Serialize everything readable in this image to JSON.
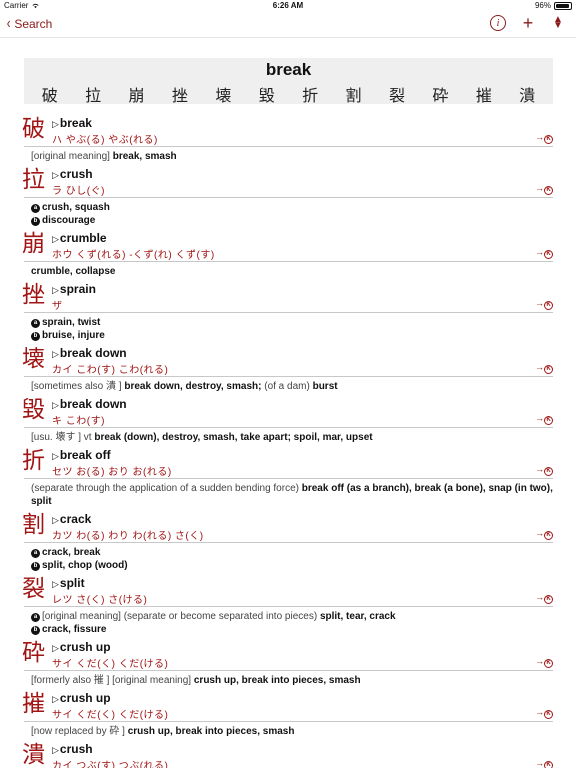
{
  "status": {
    "carrier": "Carrier",
    "time": "6:26 AM",
    "battery": "96%"
  },
  "nav": {
    "back_label": "Search"
  },
  "header": {
    "word": "break",
    "kanji": [
      "破",
      "拉",
      "崩",
      "挫",
      "壊",
      "毀",
      "折",
      "割",
      "裂",
      "砕",
      "摧",
      "潰"
    ]
  },
  "entries": [
    {
      "kanji": "破",
      "keyword": "break",
      "readings": "ハ  やぶ(る)  やぶ(れる)",
      "defs": [
        {
          "gray": "[original meaning]",
          "bold": "break, smash"
        }
      ]
    },
    {
      "kanji": "拉",
      "keyword": "crush",
      "readings": "ラ  ひし(ぐ)",
      "defs": [
        {
          "mark": "a",
          "bold": "crush, squash"
        },
        {
          "mark": "b",
          "bold": "discourage"
        }
      ]
    },
    {
      "kanji": "崩",
      "keyword": "crumble",
      "readings": "ホウ  くず(れる)  -くず(れ)  くず(す)",
      "defs": [
        {
          "bold": "crumble, collapse"
        }
      ]
    },
    {
      "kanji": "挫",
      "keyword": "sprain",
      "readings": "ザ",
      "defs": [
        {
          "mark": "a",
          "bold": "sprain, twist"
        },
        {
          "mark": "b",
          "bold": "bruise, injure"
        }
      ]
    },
    {
      "kanji": "壊",
      "keyword": "break down",
      "readings": "カイ  こわ(す)  こわ(れる)",
      "defs": [
        {
          "gray": "[sometimes also 潰 ]",
          "bold": "break down, destroy, smash;",
          "gray2": "(of a dam)",
          "bold2": "burst"
        }
      ]
    },
    {
      "kanji": "毀",
      "keyword": "break down",
      "readings": "キ  こわ(す)",
      "defs": [
        {
          "gray": "[usu. 壊す ] vt",
          "bold": "break (down), destroy, smash, take apart; spoil, mar, upset"
        }
      ]
    },
    {
      "kanji": "折",
      "keyword": "break off",
      "readings": "セツ  お(る)  おり  お(れる)",
      "defs": [
        {
          "gray": "(separate through the application of a sudden bending force)",
          "bold": "break off (as a branch), break (a bone), snap (in two), split"
        }
      ]
    },
    {
      "kanji": "割",
      "keyword": "crack",
      "readings": "カツ  わ(る)  わり  わ(れる)  さ(く)",
      "defs": [
        {
          "mark": "a",
          "bold": "crack, break"
        },
        {
          "mark": "b",
          "bold": "split, chop (wood)"
        }
      ]
    },
    {
      "kanji": "裂",
      "keyword": "split",
      "readings": "レツ  さ(く)  さ(ける)",
      "defs": [
        {
          "mark": "a",
          "gray": "[original meaning] (separate or become separated into pieces)",
          "bold": "split, tear, crack"
        },
        {
          "mark": "b",
          "bold": "crack, fissure"
        }
      ]
    },
    {
      "kanji": "砕",
      "keyword": "crush up",
      "readings": "サイ  くだ(く)  くだ(ける)",
      "defs": [
        {
          "gray": "[formerly also 摧 ] [original meaning]",
          "bold": "crush up, break into pieces, smash"
        }
      ]
    },
    {
      "kanji": "摧",
      "keyword": "crush up",
      "readings": "サイ  くだ(く)  くだ(ける)",
      "defs": [
        {
          "gray": "[now replaced by 砕 ]",
          "bold": "crush up, break into pieces, smash"
        }
      ]
    },
    {
      "kanji": "潰",
      "keyword": "crush",
      "readings": "カイ  つぶ(す)  つぶ(れる)",
      "defs": []
    }
  ],
  "colors": {
    "accent": "#a11414",
    "nav_tint": "#8b1a1a",
    "header_bg": "#efefef"
  },
  "icons": {
    "back": "chevron-left-icon",
    "info": "info-icon",
    "add": "plus-icon",
    "sort": "sort-icon",
    "link": "kanji-link-icon"
  }
}
